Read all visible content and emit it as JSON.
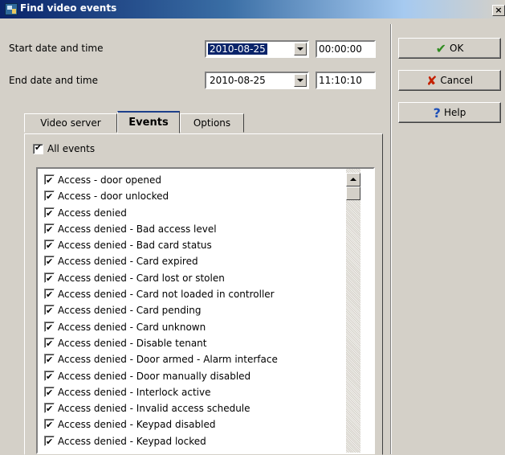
{
  "window": {
    "title": "Find video events",
    "close_glyph": "×"
  },
  "form": {
    "start_label": "Start date and time",
    "start_date": "2010-08-25",
    "start_time": "00:00:00",
    "end_label": "End date and time",
    "end_date": "2010-08-25",
    "end_time": "11:10:10"
  },
  "buttons": {
    "ok": "OK",
    "cancel": "Cancel",
    "help": "Help"
  },
  "icons": {
    "ok": "check-icon",
    "cancel": "x-icon",
    "help": "question-icon"
  },
  "tabs": [
    {
      "label": "Video server",
      "active": false
    },
    {
      "label": "Events",
      "active": true
    },
    {
      "label": "Options",
      "active": false
    }
  ],
  "events_tab": {
    "all_events_label": "All events",
    "all_events_checked": true,
    "items": [
      {
        "label": "Access - door opened",
        "checked": true
      },
      {
        "label": "Access - door unlocked",
        "checked": true
      },
      {
        "label": "Access denied",
        "checked": true
      },
      {
        "label": "Access denied - Bad access level",
        "checked": true
      },
      {
        "label": "Access denied - Bad card status",
        "checked": true
      },
      {
        "label": "Access denied - Card expired",
        "checked": true
      },
      {
        "label": "Access denied - Card lost or stolen",
        "checked": true
      },
      {
        "label": "Access denied - Card not loaded in controller",
        "checked": true
      },
      {
        "label": "Access denied - Card pending",
        "checked": true
      },
      {
        "label": "Access denied - Card unknown",
        "checked": true
      },
      {
        "label": "Access denied - Disable tenant",
        "checked": true
      },
      {
        "label": "Access denied - Door armed - Alarm interface",
        "checked": true
      },
      {
        "label": "Access denied - Door manually disabled",
        "checked": true
      },
      {
        "label": "Access denied - Interlock active",
        "checked": true
      },
      {
        "label": "Access denied - Invalid access schedule",
        "checked": true
      },
      {
        "label": "Access denied - Keypad disabled",
        "checked": true
      },
      {
        "label": "Access denied - Keypad locked",
        "checked": true
      }
    ]
  },
  "colors": {
    "title_start": "#0a246a",
    "face": "#d4d0c8",
    "selection": "#0a246a"
  }
}
